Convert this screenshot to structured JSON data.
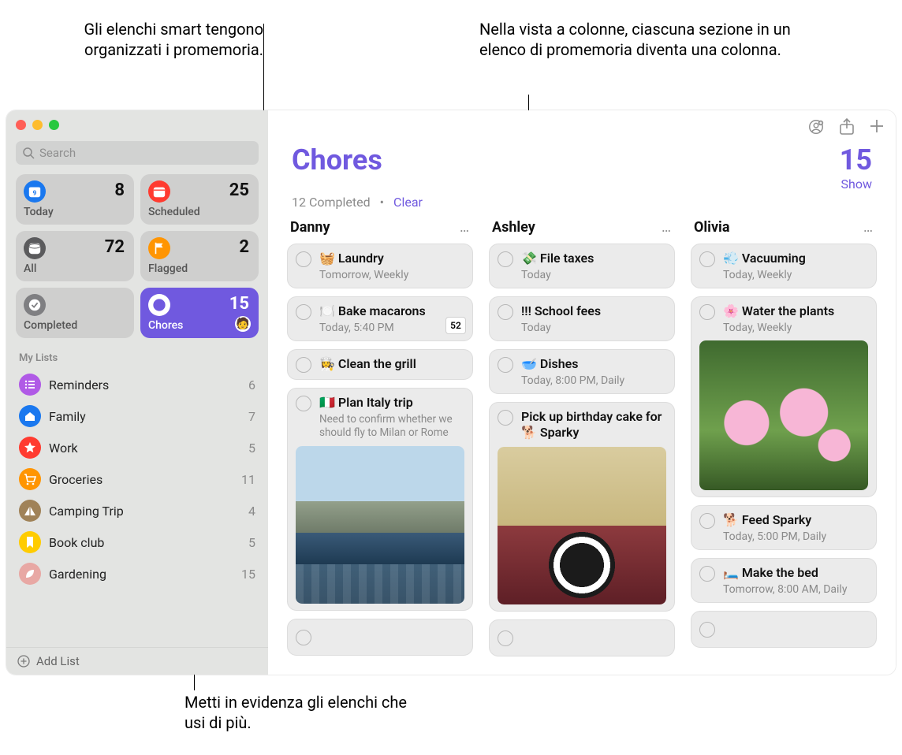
{
  "callouts": {
    "top_left": "Gli elenchi smart tengono organizzati i promemoria.",
    "top_right": "Nella vista a colonne, ciascuna sezione in un elenco di promemoria diventa una colonna.",
    "bottom": "Metti in evidenza gli elenchi che usi di più."
  },
  "search": {
    "placeholder": "Search"
  },
  "smart": [
    {
      "id": "today",
      "label": "Today",
      "count": 8,
      "color": "#1a78ef"
    },
    {
      "id": "scheduled",
      "label": "Scheduled",
      "count": 25,
      "color": "#ff3b30"
    },
    {
      "id": "all",
      "label": "All",
      "count": 72,
      "color": "#5b5b5d"
    },
    {
      "id": "flagged",
      "label": "Flagged",
      "count": 2,
      "color": "#ff9502"
    },
    {
      "id": "completed",
      "label": "Completed",
      "count": "",
      "color": "#7f7f82"
    },
    {
      "id": "chores",
      "label": "Chores",
      "count": 15,
      "color": "#ffffff",
      "selected": true,
      "shared": true
    }
  ],
  "mylists_title": "My Lists",
  "mylists": [
    {
      "name": "Reminders",
      "count": 6,
      "color": "#b05ae6",
      "glyph": "list"
    },
    {
      "name": "Family",
      "count": 7,
      "color": "#1a78ef",
      "glyph": "home"
    },
    {
      "name": "Work",
      "count": 5,
      "color": "#ff3b30",
      "glyph": "star"
    },
    {
      "name": "Groceries",
      "count": 11,
      "color": "#ff9502",
      "glyph": "cart"
    },
    {
      "name": "Camping Trip",
      "count": 4,
      "color": "#a08258",
      "glyph": "tent"
    },
    {
      "name": "Book club",
      "count": 5,
      "color": "#ffcc00",
      "glyph": "bookmark"
    },
    {
      "name": "Gardening",
      "count": 15,
      "color": "#e8a8a4",
      "glyph": "leaf"
    }
  ],
  "addlist": "Add List",
  "header": {
    "title": "Chores",
    "count": 15,
    "completed_text": "12 Completed",
    "clear": "Clear",
    "show": "Show"
  },
  "columns": [
    {
      "name": "Danny",
      "items": [
        {
          "title": "🧺 Laundry",
          "meta": "Tomorrow, Weekly"
        },
        {
          "title": "🍽️ Bake macarons",
          "meta": "Today, 5:40 PM",
          "badge": "52"
        },
        {
          "title": "👩‍🍳 Clean the grill"
        },
        {
          "title": "🇮🇹 Plan Italy trip",
          "note": "Need to confirm whether we should fly to Milan or Rome",
          "photo": "coast"
        },
        {
          "empty": true
        }
      ]
    },
    {
      "name": "Ashley",
      "items": [
        {
          "title": "💸 File taxes",
          "meta": "Today"
        },
        {
          "title": "!!! School fees",
          "meta": "Today"
        },
        {
          "title": "🥣 Dishes",
          "meta": "Today, 8:00 PM, Daily"
        },
        {
          "title": "Pick up birthday cake for 🐕 Sparky",
          "photo": "dog"
        },
        {
          "empty": true
        }
      ]
    },
    {
      "name": "Olivia",
      "items": [
        {
          "title": "💨 Vacuuming",
          "meta": "Today, Weekly"
        },
        {
          "title": "🌸 Water the plants",
          "meta": "Today, Weekly",
          "photo": "flowers"
        },
        {
          "title": "🐕 Feed Sparky",
          "meta": "Today, 5:00 PM, Daily"
        },
        {
          "title": "🛏️ Make the bed",
          "meta": "Tomorrow, 8:00 AM, Daily"
        },
        {
          "empty": true
        }
      ]
    }
  ]
}
